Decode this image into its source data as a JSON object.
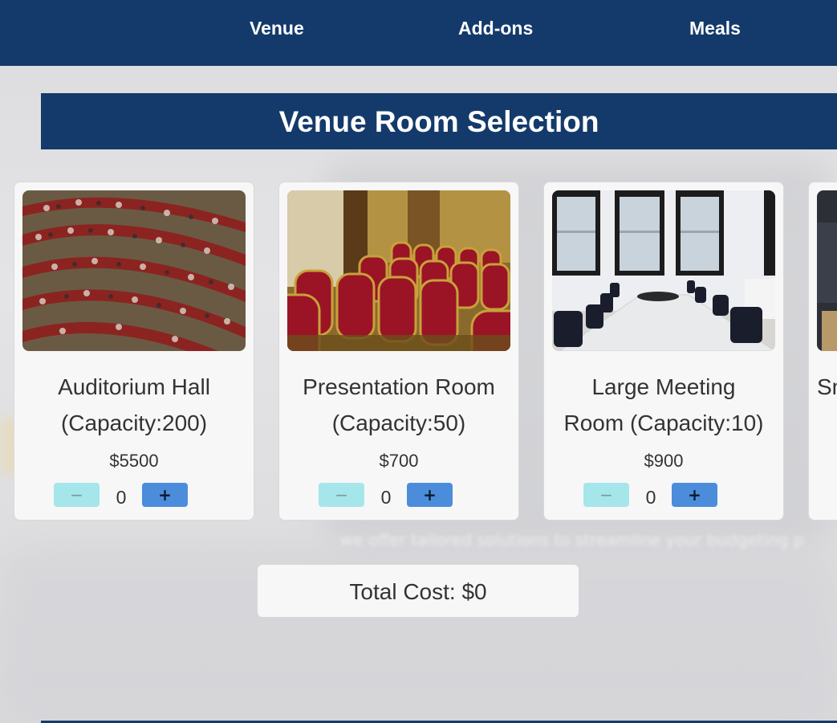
{
  "nav": {
    "items": [
      "Venue",
      "Add-ons",
      "Meals"
    ]
  },
  "section": {
    "title": "Venue Room Selection"
  },
  "rooms": [
    {
      "name_line1": "Auditorium Hall",
      "name_line2": "(Capacity:200)",
      "price": "$5500",
      "quantity": "0",
      "minus": "−",
      "plus": "+",
      "image": "auditorium-photo"
    },
    {
      "name_line1": "Presentation Room",
      "name_line2": "(Capacity:50)",
      "price": "$700",
      "quantity": "0",
      "minus": "−",
      "plus": "+",
      "image": "presentation-room-photo"
    },
    {
      "name_line1": "Large Meeting",
      "name_line2": "Room (Capacity:10)",
      "price": "$900",
      "quantity": "0",
      "minus": "−",
      "plus": "+",
      "image": "meeting-room-photo"
    },
    {
      "name_line1": "Sm",
      "image": "small-room-photo"
    }
  ],
  "total": {
    "label": "Total Cost: $0"
  },
  "background": {
    "text": "we offer tailored solutions to streamline your budgeting p"
  },
  "colors": {
    "brand": "#143a6b",
    "minus_button": "#a5e6ea",
    "plus_button": "#4b8ddb",
    "card": "#f7f7f7"
  }
}
